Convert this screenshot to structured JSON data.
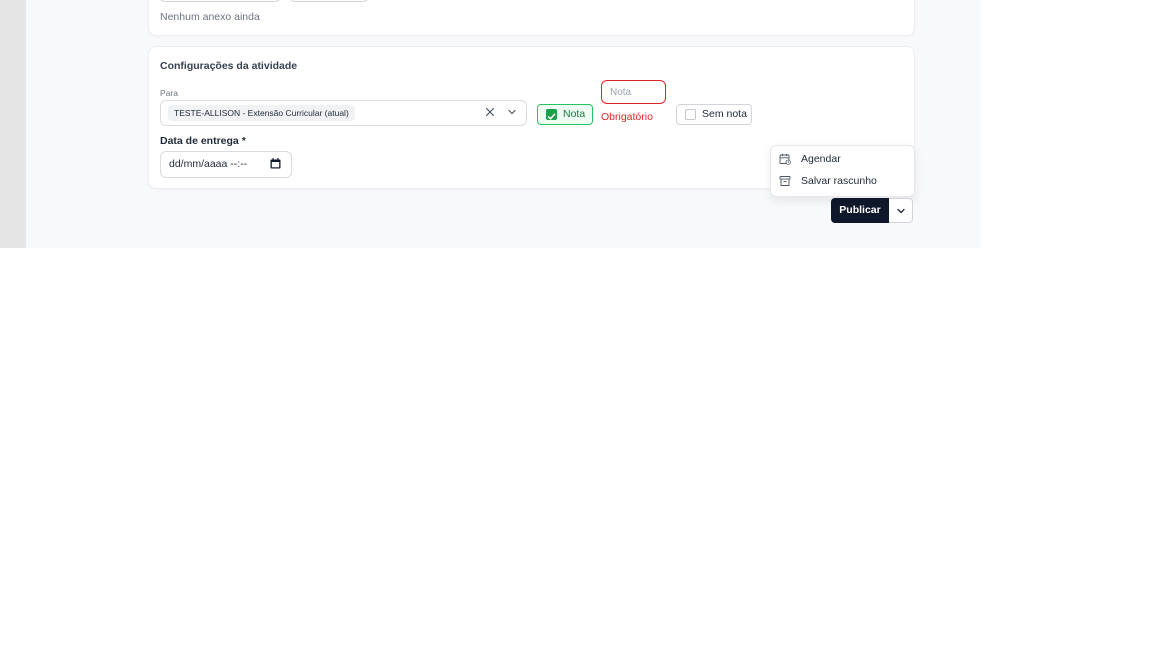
{
  "attachments": {
    "empty_text": "Nenhum anexo ainda"
  },
  "activity_settings": {
    "title": "Configurações da atividade",
    "for_label": "Para",
    "selected_class": "TESTE-ALLISON - Extensão Curricular (atual)",
    "grade_toggle_label": "Nota",
    "grade_toggle_checked": true,
    "grade_input_placeholder": "Nota",
    "grade_input_value": "",
    "grade_required_message": "Obrigatório",
    "no_grade_label": "Sem nota",
    "no_grade_checked": false,
    "due_date_label": "Data de entrega *",
    "due_date_value": "dd/mm/aaaa --:--"
  },
  "publish_menu": {
    "items": [
      {
        "label": "Agendar",
        "icon": "calendar-clock-icon"
      },
      {
        "label": "Salvar rascunho",
        "icon": "archive-icon"
      }
    ]
  },
  "actions": {
    "publish_label": "Publicar",
    "more_icon": "chevron-down-icon"
  },
  "colors": {
    "primary": "#0f172a",
    "success": "#16a34a",
    "error": "#dc2626"
  }
}
